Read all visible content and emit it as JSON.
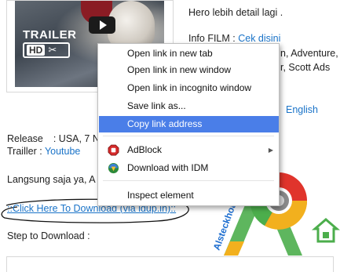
{
  "thumbnail": {
    "trailer_label": "TRAILER",
    "hd_label": "HD",
    "scissors_glyph": "✂"
  },
  "article": {
    "line1": "Hero lebih detail lagi .",
    "info_prefix": "Info FILM : ",
    "info_link": "Cek disini",
    "genre_fragment": "n, Adventure,",
    "cast_fragment": "r, Scott Ads",
    "language_link": "English",
    "release_label": "Release",
    "release_value": ": USA, 7 N",
    "trailer_label": "Trailler",
    "trailer_colon": " : ",
    "trailer_link": "Youtube",
    "langsung": "Langsung saja ya, A",
    "download_link": "::Click Here To Download (via ldup.in)::",
    "step_text": "Step to Download :"
  },
  "context_menu": {
    "items": [
      {
        "label": "Open link in new tab"
      },
      {
        "label": "Open link in new window"
      },
      {
        "label": "Open link in incognito window"
      },
      {
        "label": "Save link as..."
      },
      {
        "label": "Copy link address",
        "highlighted": true
      },
      {
        "label": "AdBlock",
        "icon": "adblock-icon",
        "submenu": true
      },
      {
        "label": "Download with IDM",
        "icon": "idm-icon"
      },
      {
        "label": "Inspect element"
      }
    ]
  },
  "watermark": {
    "text": "Alsteckhoart",
    "colors": {
      "red": "#e0342c",
      "green": "#4cae4c",
      "blue": "#1f6fd0",
      "yellow": "#f2b01e"
    }
  },
  "colors": {
    "link": "#1a73c8",
    "menu_highlight": "#4a7ee8"
  }
}
